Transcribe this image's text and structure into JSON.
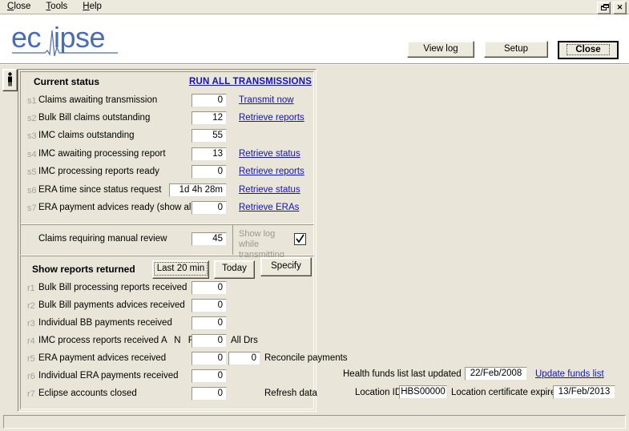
{
  "window": {
    "menu": [
      {
        "accel": "C",
        "rest": "lose"
      },
      {
        "accel": "T",
        "rest": "ools"
      },
      {
        "accel": "H",
        "rest": "elp"
      }
    ],
    "restore_button": "restore-icon",
    "close_button": "✕"
  },
  "header": {
    "logo_text": "eclipse",
    "buttons": {
      "view_log": "View log",
      "setup": "Setup",
      "close": "Close"
    }
  },
  "sidebar": {
    "person_button": "person-icon"
  },
  "status": {
    "title": "Current status",
    "run_all": "RUN ALL TRANSMISSIONS",
    "rows": [
      {
        "idx": "s1",
        "label": "Claims awaiting transmission",
        "value": "0",
        "link": "Transmit now"
      },
      {
        "idx": "s2",
        "label": "Bulk Bill claims outstanding",
        "value": "12",
        "link": "Retrieve reports"
      },
      {
        "idx": "s3",
        "label": "IMC claims outstanding",
        "value": "55",
        "link": ""
      },
      {
        "idx": "s4",
        "label": "IMC awaiting processing report",
        "value": "13",
        "link": "Retrieve status"
      },
      {
        "idx": "s5",
        "label": "IMC processing reports ready",
        "value": "0",
        "link": "Retrieve reports"
      },
      {
        "idx": "s6",
        "label": "ERA time since status request",
        "value": "1d 4h 28m",
        "link": "Retrieve status"
      },
      {
        "idx": "s7",
        "label": "ERA payment advices ready   (show all)",
        "value": "0",
        "link": "Retrieve ERAs"
      }
    ]
  },
  "review": {
    "label": "Claims requiring manual review",
    "value": "45",
    "show_log_label": "Show log while transmitting",
    "show_log_checked": "✓"
  },
  "reports": {
    "title": "Show reports returned",
    "buttons": {
      "last20": "Last 20 min",
      "today": "Today",
      "specify": "Specify"
    },
    "all_drs_header": "All Drs",
    "anr": "A  N  R",
    "reconcile": "Reconcile payments",
    "refresh": "Refresh data",
    "rows": [
      {
        "idx": "r1",
        "label": "Bulk Bill processing reports received",
        "value": "0",
        "value2": ""
      },
      {
        "idx": "r2",
        "label": "Bulk Bill payments advices received",
        "value": "0",
        "value2": ""
      },
      {
        "idx": "r3",
        "label": "Individual BB payments received",
        "value": "0",
        "value2": ""
      },
      {
        "idx": "r4",
        "label": "IMC process reports received",
        "value": "0",
        "value2": ""
      },
      {
        "idx": "r5",
        "label": "ERA payment advices received",
        "value": "0",
        "value2": "0"
      },
      {
        "idx": "r6",
        "label": "Individual ERA payments received",
        "value": "0",
        "value2": ""
      },
      {
        "idx": "r7",
        "label": "Eclipse accounts closed",
        "value": "0",
        "value2": ""
      }
    ]
  },
  "info": {
    "funds_label": "Health funds list last updated",
    "funds_date": "22/Feb/2008",
    "funds_link": "Update funds list",
    "location_label": "Location ID:",
    "location_id": "HBS00000",
    "cert_label": "Location certificate expires",
    "cert_date": "13/Feb/2013"
  },
  "colors": {
    "background": "#e9e5d8",
    "link": "#1212c8",
    "logo": "#4a6bb5",
    "field_bg": "#ffffff",
    "disabled_text": "#9c9789"
  }
}
